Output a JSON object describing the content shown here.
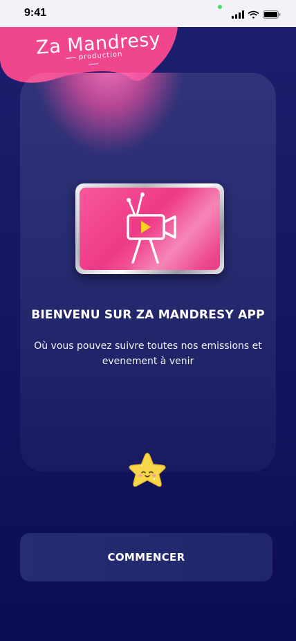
{
  "status_bar": {
    "time": "9:41"
  },
  "logo": {
    "title": "Za Mandresy",
    "subtitle": "production",
    "color": "#f0468e"
  },
  "welcome": {
    "title": "BIENVENU SUR ZA MANDRESY APP",
    "text": "Où vous pouvez suivre toutes nos emissions et evenement à venir"
  },
  "actions": {
    "start_label": "COMMENCER"
  },
  "icons": {
    "cellular": "cellular-signal-icon",
    "wifi": "wifi-icon",
    "battery": "battery-icon",
    "tv": "tv-camera-icon",
    "mascot": "smiling-star-icon"
  },
  "colors": {
    "background": "#141862",
    "accent": "#f0468e",
    "button": "#222a70",
    "star": "#f7d64a"
  }
}
